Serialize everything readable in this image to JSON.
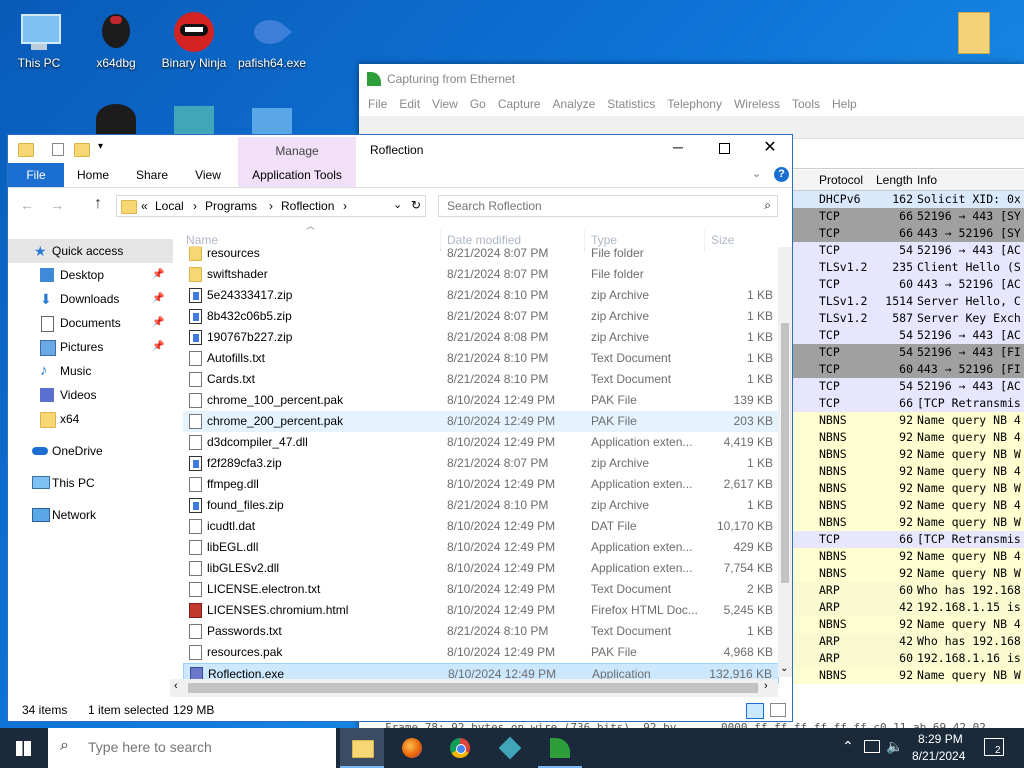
{
  "desktop": {
    "icons": [
      {
        "label": "This PC"
      },
      {
        "label": "x64dbg"
      },
      {
        "label": "Binary Ninja"
      },
      {
        "label": "pafish64.exe"
      }
    ]
  },
  "wireshark": {
    "title": "Capturing from Ethernet",
    "menu": [
      "File",
      "Edit",
      "View",
      "Go",
      "Capture",
      "Analyze",
      "Statistics",
      "Telephony",
      "Wireless",
      "Tools",
      "Help"
    ],
    "columns": {
      "protocol": "Protocol",
      "length": "Length",
      "info": "Info"
    },
    "packets": [
      {
        "protocol": "DHCPv6",
        "length": "162",
        "info": "Solicit XID: 0x"
      },
      {
        "protocol": "TCP",
        "length": "66",
        "info": "52196 → 443 [SY"
      },
      {
        "protocol": "TCP",
        "length": "66",
        "info": "443 → 52196 [SY"
      },
      {
        "protocol": "TCP",
        "length": "54",
        "info": "52196 → 443 [AC"
      },
      {
        "protocol": "TLSv1.2",
        "length": "235",
        "info": "Client Hello (S"
      },
      {
        "protocol": "TCP",
        "length": "60",
        "info": "443 → 52196 [AC"
      },
      {
        "protocol": "TLSv1.2",
        "length": "1514",
        "info": "Server Hello, C"
      },
      {
        "protocol": "TLSv1.2",
        "length": "587",
        "info": "Server Key Exch"
      },
      {
        "protocol": "TCP",
        "length": "54",
        "info": "52196 → 443 [AC"
      },
      {
        "protocol": "TCP",
        "length": "54",
        "info": "52196 → 443 [FI"
      },
      {
        "protocol": "TCP",
        "length": "60",
        "info": "443 → 52196 [FI"
      },
      {
        "protocol": "TCP",
        "length": "54",
        "info": "52196 → 443 [AC"
      },
      {
        "protocol": "TCP",
        "length": "66",
        "info": "[TCP Retransmis"
      },
      {
        "protocol": "NBNS",
        "length": "92",
        "info": "Name query NB 4"
      },
      {
        "protocol": "NBNS",
        "length": "92",
        "info": "Name query NB 4"
      },
      {
        "protocol": "NBNS",
        "length": "92",
        "info": "Name query NB W"
      },
      {
        "protocol": "NBNS",
        "length": "92",
        "info": "Name query NB 4"
      },
      {
        "protocol": "NBNS",
        "length": "92",
        "info": "Name query NB W"
      },
      {
        "protocol": "NBNS",
        "length": "92",
        "info": "Name query NB 4"
      },
      {
        "protocol": "NBNS",
        "length": "92",
        "info": "Name query NB W"
      },
      {
        "protocol": "TCP",
        "length": "66",
        "info": "[TCP Retransmis"
      },
      {
        "protocol": "NBNS",
        "length": "92",
        "info": "Name query NB 4"
      },
      {
        "protocol": "NBNS",
        "length": "92",
        "info": "Name query NB W"
      },
      {
        "protocol": "ARP",
        "length": "60",
        "info": "Who has 192.168"
      },
      {
        "protocol": "ARP",
        "length": "42",
        "info": "192.168.1.15 is"
      },
      {
        "protocol": "NBNS",
        "length": "92",
        "info": "Name query NB 4"
      },
      {
        "protocol": "ARP",
        "length": "42",
        "info": "Who has 192.168"
      },
      {
        "protocol": "ARP",
        "length": "60",
        "info": "192.168.1.16 is"
      },
      {
        "protocol": "NBNS",
        "length": "92",
        "info": "Name query NB W"
      }
    ],
    "bottom_text": "Frame 78: 92 bytes on wire (736 bits), 92 by",
    "hex_text": "0000  ff ff ff ff ff ff c0 11  ab 69 42 02"
  },
  "explorer": {
    "title": "Roflection",
    "tabs": {
      "file": "File",
      "home": "Home",
      "share": "Share",
      "view": "View",
      "manage": "Manage",
      "app_tools": "Application Tools"
    },
    "breadcrumb": [
      "«",
      "Local",
      "Programs",
      "Roflection"
    ],
    "search_placeholder": "Search Roflection",
    "columns": {
      "name": "Name",
      "date": "Date modified",
      "type": "Type",
      "size": "Size"
    },
    "sidebar": [
      {
        "label": "Quick access"
      },
      {
        "label": "Desktop"
      },
      {
        "label": "Downloads"
      },
      {
        "label": "Documents"
      },
      {
        "label": "Pictures"
      },
      {
        "label": "Music"
      },
      {
        "label": "Videos"
      },
      {
        "label": "x64"
      },
      {
        "label": "OneDrive"
      },
      {
        "label": "This PC"
      },
      {
        "label": "Network"
      }
    ],
    "files": [
      {
        "name": "resources",
        "date": "8/21/2024 8:07 PM",
        "type": "File folder",
        "size": "",
        "icon": "folder"
      },
      {
        "name": "swiftshader",
        "date": "8/21/2024 8:07 PM",
        "type": "File folder",
        "size": "",
        "icon": "folder"
      },
      {
        "name": "5e24333417.zip",
        "date": "8/21/2024 8:10 PM",
        "type": "zip Archive",
        "size": "1 KB",
        "icon": "zip"
      },
      {
        "name": "8b432c06b5.zip",
        "date": "8/21/2024 8:07 PM",
        "type": "zip Archive",
        "size": "1 KB",
        "icon": "zip"
      },
      {
        "name": "190767b227.zip",
        "date": "8/21/2024 8:08 PM",
        "type": "zip Archive",
        "size": "1 KB",
        "icon": "zip"
      },
      {
        "name": "Autofills.txt",
        "date": "8/21/2024 8:10 PM",
        "type": "Text Document",
        "size": "1 KB",
        "icon": "doc"
      },
      {
        "name": "Cards.txt",
        "date": "8/21/2024 8:10 PM",
        "type": "Text Document",
        "size": "1 KB",
        "icon": "doc"
      },
      {
        "name": "chrome_100_percent.pak",
        "date": "8/10/2024 12:49 PM",
        "type": "PAK File",
        "size": "139 KB",
        "icon": "doc"
      },
      {
        "name": "chrome_200_percent.pak",
        "date": "8/10/2024 12:49 PM",
        "type": "PAK File",
        "size": "203 KB",
        "icon": "doc"
      },
      {
        "name": "d3dcompiler_47.dll",
        "date": "8/10/2024 12:49 PM",
        "type": "Application exten...",
        "size": "4,419 KB",
        "icon": "doc"
      },
      {
        "name": "f2f289cfa3.zip",
        "date": "8/21/2024 8:07 PM",
        "type": "zip Archive",
        "size": "1 KB",
        "icon": "zip"
      },
      {
        "name": "ffmpeg.dll",
        "date": "8/10/2024 12:49 PM",
        "type": "Application exten...",
        "size": "2,617 KB",
        "icon": "doc"
      },
      {
        "name": "found_files.zip",
        "date": "8/21/2024 8:10 PM",
        "type": "zip Archive",
        "size": "1 KB",
        "icon": "zip"
      },
      {
        "name": "icudtl.dat",
        "date": "8/10/2024 12:49 PM",
        "type": "DAT File",
        "size": "10,170 KB",
        "icon": "doc"
      },
      {
        "name": "libEGL.dll",
        "date": "8/10/2024 12:49 PM",
        "type": "Application exten...",
        "size": "429 KB",
        "icon": "doc"
      },
      {
        "name": "libGLESv2.dll",
        "date": "8/10/2024 12:49 PM",
        "type": "Application exten...",
        "size": "7,754 KB",
        "icon": "doc"
      },
      {
        "name": "LICENSE.electron.txt",
        "date": "8/10/2024 12:49 PM",
        "type": "Text Document",
        "size": "2 KB",
        "icon": "doc"
      },
      {
        "name": "LICENSES.chromium.html",
        "date": "8/10/2024 12:49 PM",
        "type": "Firefox HTML Doc...",
        "size": "5,245 KB",
        "icon": "html"
      },
      {
        "name": "Passwords.txt",
        "date": "8/21/2024 8:10 PM",
        "type": "Text Document",
        "size": "1 KB",
        "icon": "doc"
      },
      {
        "name": "resources.pak",
        "date": "8/10/2024 12:49 PM",
        "type": "PAK File",
        "size": "4,968 KB",
        "icon": "doc"
      },
      {
        "name": "Roflection.exe",
        "date": "8/10/2024 12:49 PM",
        "type": "Application",
        "size": "132,916 KB",
        "icon": "app"
      }
    ],
    "status": {
      "count": "34 items",
      "selected": "1 item selected",
      "size": "129 MB"
    }
  },
  "taskbar": {
    "search_placeholder": "Type here to search",
    "time": "8:29 PM",
    "date": "8/21/2024",
    "notification_count": "2"
  }
}
